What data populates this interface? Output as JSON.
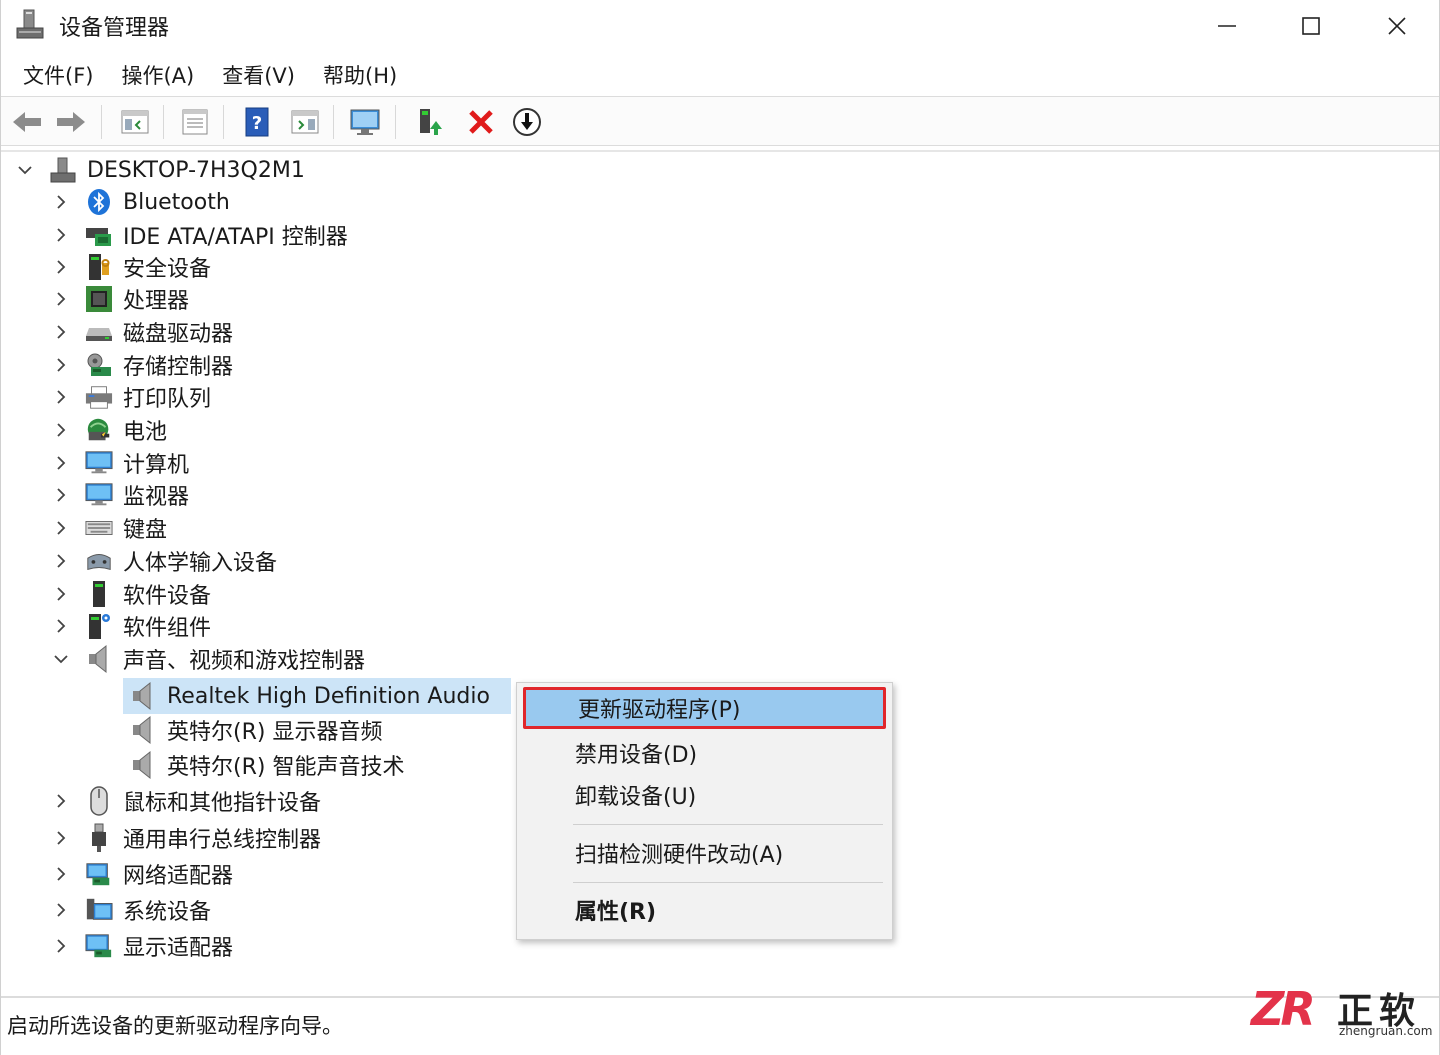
{
  "window": {
    "title": "设备管理器",
    "accent_color": "#0078d7",
    "selection_color": "#cce4f7"
  },
  "menubar": [
    "文件(F)",
    "操作(A)",
    "查看(V)",
    "帮助(H)"
  ],
  "toolbar": {
    "buttons": [
      "back-icon",
      "forward-icon",
      "show-hide-console-tree-icon",
      "properties-icon",
      "help-icon",
      "show-hide-action-pane-icon",
      "scan-hardware-icon",
      "update-driver-icon",
      "uninstall-device-icon",
      "disable-device-icon"
    ]
  },
  "tree": {
    "root": "DESKTOP-7H3Q2M1",
    "categories": [
      {
        "label": "Bluetooth",
        "icon": "bluetooth-icon"
      },
      {
        "label": "IDE ATA/ATAPI 控制器",
        "icon": "ide-controller-icon"
      },
      {
        "label": "安全设备",
        "icon": "security-device-icon"
      },
      {
        "label": "处理器",
        "icon": "processor-icon"
      },
      {
        "label": "磁盘驱动器",
        "icon": "disk-drive-icon"
      },
      {
        "label": "存储控制器",
        "icon": "storage-controller-icon"
      },
      {
        "label": "打印队列",
        "icon": "printer-icon"
      },
      {
        "label": "电池",
        "icon": "battery-icon"
      },
      {
        "label": "计算机",
        "icon": "computer-icon"
      },
      {
        "label": "监视器",
        "icon": "monitor-icon"
      },
      {
        "label": "键盘",
        "icon": "keyboard-icon"
      },
      {
        "label": "人体学输入设备",
        "icon": "hid-icon"
      },
      {
        "label": "软件设备",
        "icon": "software-device-icon"
      },
      {
        "label": "软件组件",
        "icon": "software-component-icon"
      },
      {
        "label": "声音、视频和游戏控制器",
        "icon": "speaker-icon",
        "expanded": true
      }
    ],
    "audio_children": [
      {
        "label": "Realtek High Definition Audio",
        "selected": true
      },
      {
        "label": "英特尔(R) 显示器音频"
      },
      {
        "label": "英特尔(R) 智能声音技术"
      }
    ],
    "after_categories": [
      {
        "label": "鼠标和其他指针设备",
        "icon": "mouse-icon"
      },
      {
        "label": "通用串行总线控制器",
        "icon": "usb-icon"
      },
      {
        "label": "网络适配器",
        "icon": "network-adapter-icon"
      },
      {
        "label": "系统设备",
        "icon": "system-device-icon"
      },
      {
        "label": "显示适配器",
        "icon": "display-adapter-icon"
      }
    ]
  },
  "context_menu": {
    "items": [
      "更新驱动程序(P)",
      "禁用设备(D)",
      "卸载设备(U)",
      "扫描检测硬件改动(A)",
      "属性(R)"
    ],
    "highlighted_index": 0,
    "highlight_border_color": "#e0262b"
  },
  "statusbar": {
    "text": "启动所选设备的更新驱动程序向导。"
  },
  "watermark": {
    "logo": "ZR",
    "name": "正软",
    "url": "zhengruan.com"
  }
}
